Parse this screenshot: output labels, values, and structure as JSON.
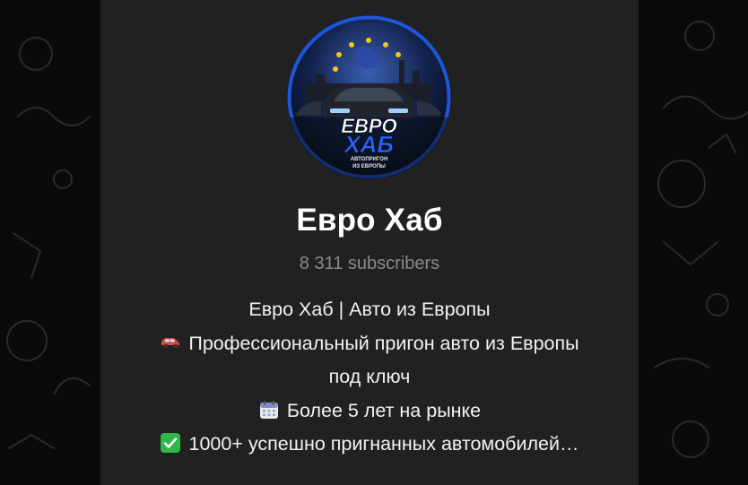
{
  "channel": {
    "title": "Евро Хаб",
    "subscribers": "8 311 subscribers",
    "avatar": {
      "icon": "channel-logo",
      "logo_word_1": "ЕВРО",
      "logo_word_2": "ХАБ",
      "logo_tagline_1": "АВТОПРИГОН",
      "logo_tagline_2": "ИЗ ЕВРОПЫ"
    },
    "description": [
      {
        "icon": "",
        "text": "Евро Хаб | Авто из Европы"
      },
      {
        "icon": "car-emoji-icon",
        "text": "Профессиональный пригон авто из Европы"
      },
      {
        "icon": "",
        "text": "под ключ"
      },
      {
        "icon": "calendar-emoji-icon",
        "text": "Более 5 лет на рынке"
      },
      {
        "icon": "check-mark-emoji-icon",
        "text": "1000+ успешно пригнанных автомобилей…"
      }
    ]
  },
  "colors": {
    "background": "#0a0a0a",
    "card": "#212121",
    "title": "#ffffff",
    "subtitle": "#8b8b8b",
    "text": "#f2f2f2",
    "logo_blue": "#1e56d9",
    "check_green": "#2eb84a"
  }
}
